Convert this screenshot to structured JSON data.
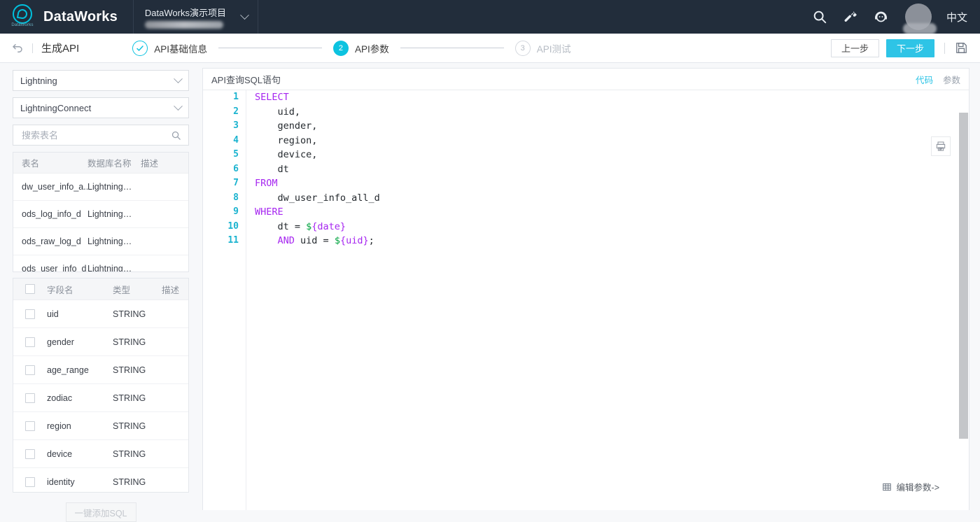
{
  "topnav": {
    "logo_word": "DataWorks",
    "brand": "DataWorks",
    "project_name": "DataWorks演示项目",
    "icons": [
      "search-icon",
      "wrench-icon",
      "headset-icon"
    ],
    "lang": "中文"
  },
  "subheader": {
    "back_icon": "back-arrow-icon",
    "title": "生成API",
    "steps": [
      {
        "marker": "✓",
        "label": "API基础信息",
        "state": "done"
      },
      {
        "marker": "2",
        "label": "API参数",
        "state": "active"
      },
      {
        "marker": "3",
        "label": "API测试",
        "state": "todo"
      }
    ],
    "prev_label": "上一步",
    "next_label": "下一步",
    "save_icon": "save-icon"
  },
  "left": {
    "datasource_type": "Lightning",
    "datasource_name": "LightningConnect",
    "search_placeholder": "搜索表名",
    "tables": {
      "columns": [
        "表名",
        "数据库名称",
        "描述"
      ],
      "rows": [
        {
          "name": "dw_user_info_a...",
          "db": "Lightning…",
          "desc": ""
        },
        {
          "name": "ods_log_info_d",
          "db": "Lightning…",
          "desc": ""
        },
        {
          "name": "ods_raw_log_d",
          "db": "Lightning…",
          "desc": ""
        },
        {
          "name": "ods_user_info_d",
          "db": "Lightning…",
          "desc": ""
        }
      ]
    },
    "fields": {
      "columns": [
        "字段名",
        "类型",
        "描述"
      ],
      "rows": [
        {
          "name": "uid",
          "type": "STRING",
          "desc": ""
        },
        {
          "name": "gender",
          "type": "STRING",
          "desc": ""
        },
        {
          "name": "age_range",
          "type": "STRING",
          "desc": ""
        },
        {
          "name": "zodiac",
          "type": "STRING",
          "desc": ""
        },
        {
          "name": "region",
          "type": "STRING",
          "desc": ""
        },
        {
          "name": "device",
          "type": "STRING",
          "desc": ""
        },
        {
          "name": "identity",
          "type": "STRING",
          "desc": ""
        }
      ]
    },
    "add_sql_label": "一键添加SQL"
  },
  "editor": {
    "title": "API查询SQL语句",
    "tab_code": "代码",
    "tab_params": "参数",
    "format_icon": "format-sql-icon",
    "edit_params_label": "编辑参数->",
    "grid_icon": "grid-icon",
    "line_numbers": [
      "1",
      "2",
      "3",
      "4",
      "5",
      "6",
      "7",
      "8",
      "9",
      "10",
      "11"
    ],
    "code_lines": [
      {
        "parts": [
          {
            "t": "SELECT",
            "c": "kw"
          }
        ]
      },
      {
        "parts": [
          {
            "t": "    uid,",
            "c": ""
          }
        ]
      },
      {
        "parts": [
          {
            "t": "    gender,",
            "c": ""
          }
        ]
      },
      {
        "parts": [
          {
            "t": "    region,",
            "c": ""
          }
        ]
      },
      {
        "parts": [
          {
            "t": "    device,",
            "c": ""
          }
        ]
      },
      {
        "parts": [
          {
            "t": "    dt",
            "c": ""
          }
        ]
      },
      {
        "parts": [
          {
            "t": "FROM",
            "c": "kw"
          }
        ]
      },
      {
        "parts": [
          {
            "t": "    dw_user_info_all_d",
            "c": ""
          }
        ]
      },
      {
        "parts": [
          {
            "t": "WHERE",
            "c": "kw"
          }
        ]
      },
      {
        "parts": [
          {
            "t": "    dt = ",
            "c": ""
          },
          {
            "t": "$",
            "c": "var-d"
          },
          {
            "t": "{date}",
            "c": "var-n"
          }
        ]
      },
      {
        "parts": [
          {
            "t": "    ",
            "c": ""
          },
          {
            "t": "AND",
            "c": "kw"
          },
          {
            "t": " uid = ",
            "c": ""
          },
          {
            "t": "$",
            "c": "var-d"
          },
          {
            "t": "{uid}",
            "c": "var-n"
          },
          {
            "t": ";",
            "c": ""
          }
        ]
      }
    ]
  },
  "colors": {
    "nav_bg": "#222d3b",
    "accent": "#2ec4e6",
    "keyword": "#a626f0",
    "line_number": "#1ab3cf",
    "dollar": "#00a33f"
  }
}
